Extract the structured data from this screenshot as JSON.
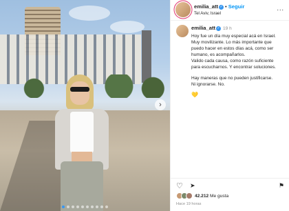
{
  "post": {
    "username": "emilia_att",
    "location": "Tel Aviv, Israel",
    "follow_label": "Seguir",
    "separator": "•",
    "more_label": "...",
    "time_short": "19 h",
    "caption_p1": "Hoy fue un día muy especial acá en Israel.\nMuy movilizante. Lo más importante que\npuedo hacer en estos días acá, como ser\nhumano, es acompañarlos.\nValido cada causa, como razón suficiente\npara escucharnos. Y encontrar soluciones.",
    "caption_p2": "Hay maneras que no pueden justificarse.\nNi ignorarse. No.",
    "emoji": "💛",
    "likes_count": "42.212",
    "likes_label": "Me gusta",
    "time_ago": "Hace 19 horas"
  },
  "icons": {
    "verified": "✓",
    "like": "♡",
    "share": "➤",
    "save": "⚑",
    "next": "›"
  },
  "photo": {
    "slide_count": 10,
    "active_slide": 1
  },
  "colors": {
    "accent": "#0095f6",
    "verified": "#3897f0",
    "muted": "#8e8e8e"
  }
}
